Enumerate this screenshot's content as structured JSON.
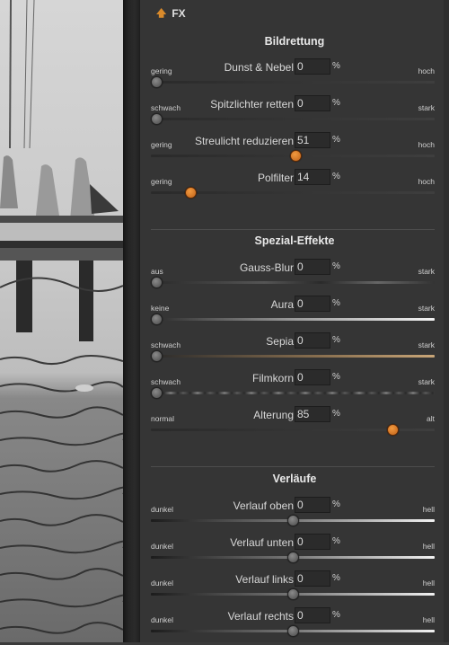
{
  "panel": {
    "title": "FX",
    "arrow_icon": "arrow-up-icon",
    "accent": "#d9822b"
  },
  "sections": [
    {
      "title": "Bildrettung",
      "sliders": [
        {
          "name": "Dunst & Nebel",
          "value": "0",
          "unit": "%",
          "min_label": "gering",
          "max_label": "hoch",
          "level": 0.02,
          "thumb": "gray",
          "track": "plain"
        },
        {
          "name": "Spitzlichter retten",
          "value": "0",
          "unit": "%",
          "min_label": "schwach",
          "max_label": "stark",
          "level": 0.02,
          "thumb": "gray",
          "track": "plain"
        },
        {
          "name": "Streulicht reduzieren",
          "value": "51",
          "unit": "%",
          "min_label": "gering",
          "max_label": "hoch",
          "level": 0.51,
          "thumb": "orange",
          "track": "plain"
        },
        {
          "name": "Polfilter",
          "value": "14",
          "unit": "%",
          "min_label": "gering",
          "max_label": "hoch",
          "level": 0.14,
          "thumb": "orange",
          "track": "plain"
        }
      ]
    },
    {
      "title": "Spezial-Effekte",
      "sliders": [
        {
          "name": "Gauss-Blur",
          "value": "0",
          "unit": "%",
          "min_label": "aus",
          "max_label": "stark",
          "level": 0.02,
          "thumb": "gray",
          "track": "blur"
        },
        {
          "name": "Aura",
          "value": "0",
          "unit": "%",
          "min_label": "keine",
          "max_label": "stark",
          "level": 0.02,
          "thumb": "gray",
          "track": "bright"
        },
        {
          "name": "Sepia",
          "value": "0",
          "unit": "%",
          "min_label": "schwach",
          "max_label": "stark",
          "level": 0.02,
          "thumb": "gray",
          "track": "sepia"
        },
        {
          "name": "Filmkorn",
          "value": "0",
          "unit": "%",
          "min_label": "schwach",
          "max_label": "stark",
          "level": 0.02,
          "thumb": "gray",
          "track": "grain"
        },
        {
          "name": "Alterung",
          "value": "85",
          "unit": "%",
          "min_label": "normal",
          "max_label": "alt",
          "level": 0.85,
          "thumb": "orange",
          "track": "plain"
        }
      ]
    },
    {
      "title": "Verläufe",
      "sliders": [
        {
          "name": "Verlauf oben",
          "value": "0",
          "unit": "%",
          "min_label": "dunkel",
          "max_label": "hell",
          "level": 0.5,
          "thumb": "gray",
          "track": "dark-light"
        },
        {
          "name": "Verlauf unten",
          "value": "0",
          "unit": "%",
          "min_label": "dunkel",
          "max_label": "hell",
          "level": 0.5,
          "thumb": "gray",
          "track": "dark-light"
        },
        {
          "name": "Verlauf links",
          "value": "0",
          "unit": "%",
          "min_label": "dunkel",
          "max_label": "hell",
          "level": 0.5,
          "thumb": "gray",
          "track": "dark-light"
        },
        {
          "name": "Verlauf rechts",
          "value": "0",
          "unit": "%",
          "min_label": "dunkel",
          "max_label": "hell",
          "level": 0.5,
          "thumb": "gray",
          "track": "dark-light"
        }
      ]
    }
  ]
}
